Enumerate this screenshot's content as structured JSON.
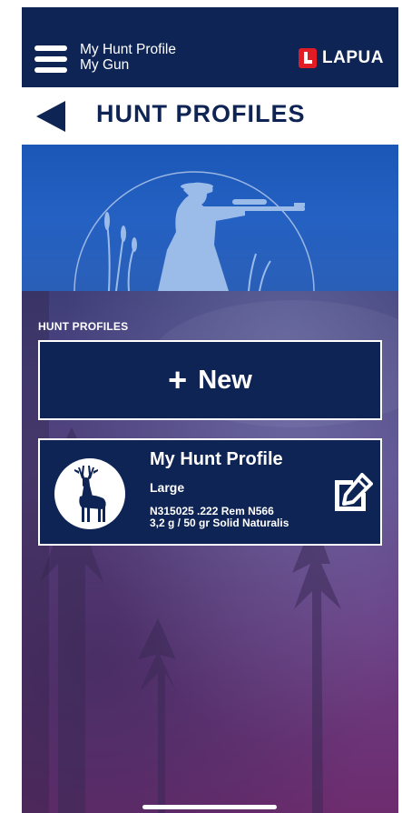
{
  "header": {
    "profile_name": "My Hunt Profile",
    "gun_name": "My Gun",
    "brand": "LAPUA",
    "colors": {
      "navy": "#0e2454",
      "brand_red": "#e21c25",
      "hero_blue": "#2461c2"
    }
  },
  "title_bar": {
    "title": "HUNT PROFILES",
    "back_icon": "back-arrow-icon"
  },
  "hero": {
    "illustration": "hunter-aiming-rifle-illustration"
  },
  "list": {
    "section_label": "HUNT PROFILES",
    "new_button": {
      "icon": "+",
      "label": "New"
    },
    "profiles": [
      {
        "name": "My Hunt Profile",
        "size": "Large",
        "ammo_line1": "N315025 .222 Rem N566",
        "ammo_line2": "3,2 g / 50 gr  Solid Naturalis",
        "badge_icon": "deer-icon",
        "edit_icon": "edit-icon"
      }
    ]
  }
}
